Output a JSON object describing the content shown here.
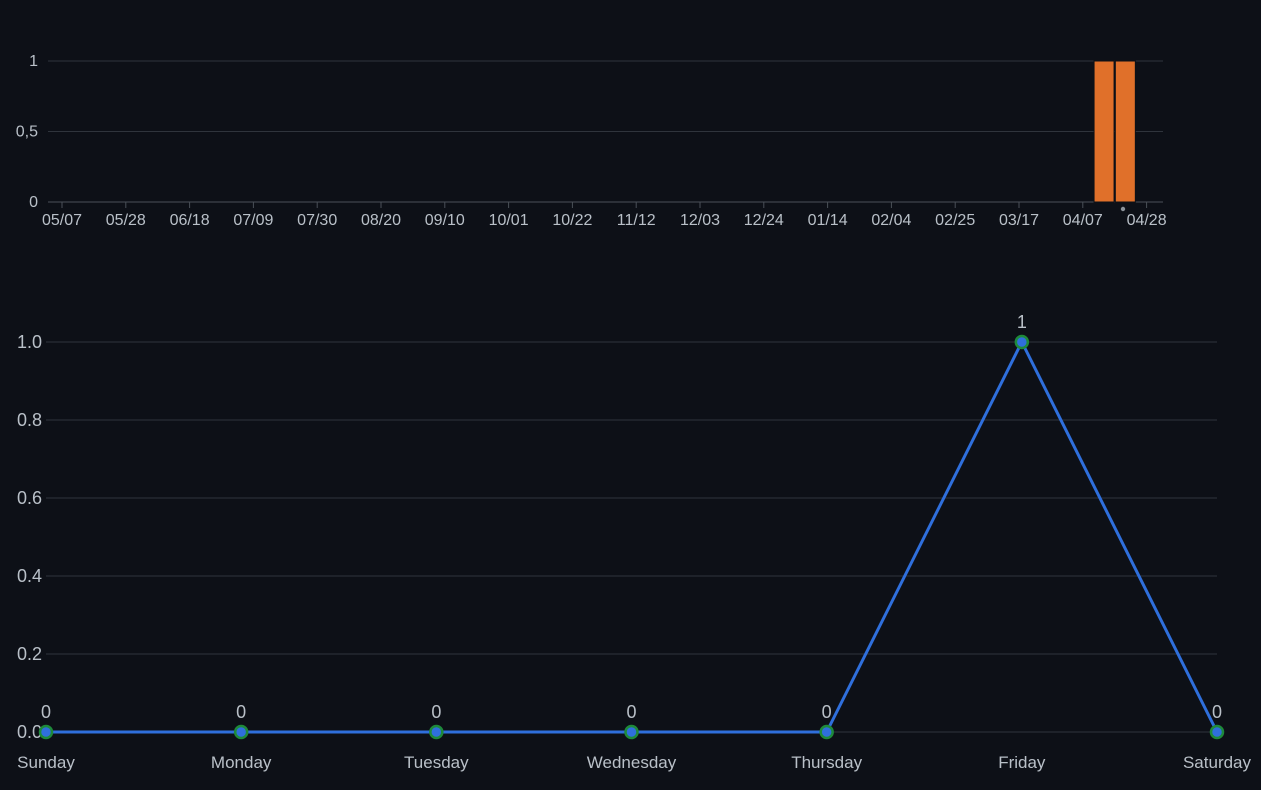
{
  "colors": {
    "background": "#0d1017",
    "grid": "#2f343c",
    "axis": "#4a5058",
    "text": "#b9c0c8",
    "bar": "#e0702a",
    "line": "#2f6fdc",
    "point_fill": "#2f6fdc",
    "point_stroke": "#1e8a3a"
  },
  "chart_data": [
    {
      "type": "bar",
      "title": "",
      "xlabel": "",
      "ylabel": "",
      "ylim": [
        0,
        1
      ],
      "yticks": [
        "0",
        "0,5",
        "1"
      ],
      "ytick_values": [
        0,
        0.5,
        1
      ],
      "x_ticks": [
        "05/07",
        "05/28",
        "06/18",
        "07/09",
        "07/30",
        "08/20",
        "09/10",
        "10/01",
        "10/22",
        "11/12",
        "12/03",
        "12/24",
        "01/14",
        "02/04",
        "02/25",
        "03/17",
        "04/07",
        "04/28"
      ],
      "bars": [
        {
          "x": "04/14",
          "value": 1
        },
        {
          "x": "04/21",
          "value": 1
        }
      ],
      "grid": true
    },
    {
      "type": "line",
      "title": "",
      "xlabel": "",
      "ylabel": "",
      "ylim": [
        0,
        1
      ],
      "yticks": [
        "0.0",
        "0.2",
        "0.4",
        "0.6",
        "0.8",
        "1.0"
      ],
      "ytick_values": [
        0,
        0.2,
        0.4,
        0.6,
        0.8,
        1.0
      ],
      "categories": [
        "Sunday",
        "Monday",
        "Tuesday",
        "Wednesday",
        "Thursday",
        "Friday",
        "Saturday"
      ],
      "values": [
        0,
        0,
        0,
        0,
        0,
        1,
        0
      ],
      "data_labels": [
        "0",
        "0",
        "0",
        "0",
        "0",
        "1",
        "0"
      ],
      "grid": true
    }
  ]
}
